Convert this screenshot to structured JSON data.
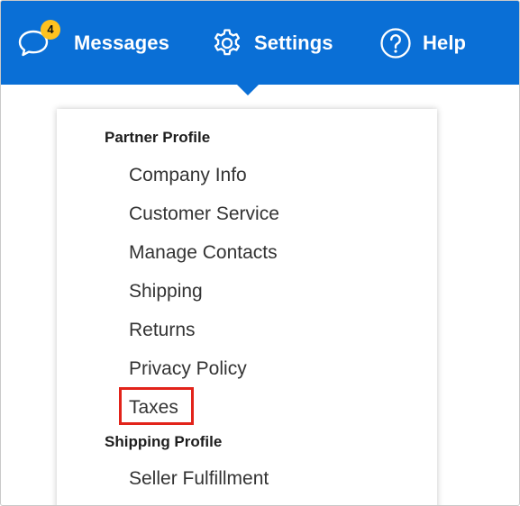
{
  "header": {
    "messages": {
      "label": "Messages",
      "badge_count": "4",
      "icon": "chat-bubble-icon"
    },
    "settings": {
      "label": "Settings",
      "icon": "gear-icon"
    },
    "help": {
      "label": "Help",
      "icon": "question-circle-icon"
    },
    "bg_color": "#0a6fd6"
  },
  "dropdown": {
    "partner_profile": {
      "title": "Partner Profile",
      "items": [
        "Company Info",
        "Customer Service",
        "Manage Contacts",
        "Shipping",
        "Returns",
        "Privacy Policy",
        "Taxes"
      ]
    },
    "shipping_profile": {
      "title": "Shipping Profile",
      "items": [
        "Seller Fulfillment"
      ]
    },
    "highlighted_item": "Taxes",
    "highlight_color": "#e2231a"
  }
}
